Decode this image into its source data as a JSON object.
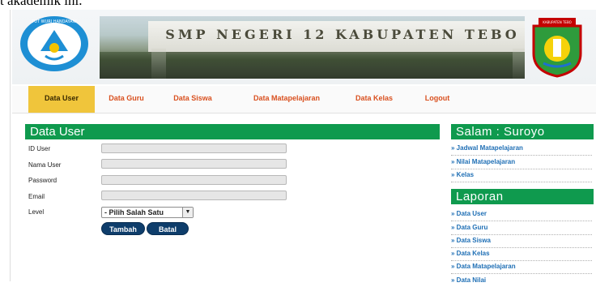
{
  "caption": "t akademik ini.",
  "banner": {
    "school_name": "SMP NEGERI 12 KABUPATEN TEBO",
    "left_logo_text": "TUT WURI HANDAYANI",
    "right_logo_text": "KABUPATEN TEBO"
  },
  "nav": {
    "items": [
      {
        "label": "Data User"
      },
      {
        "label": "Data Guru"
      },
      {
        "label": "Data Siswa"
      },
      {
        "label": "Data Matapelajaran"
      },
      {
        "label": "Data Kelas"
      },
      {
        "label": "Logout"
      }
    ]
  },
  "form": {
    "title": "Data User",
    "fields": [
      {
        "label": "ID User",
        "value": ""
      },
      {
        "label": "Nama User",
        "value": ""
      },
      {
        "label": "Password",
        "value": ""
      },
      {
        "label": "Email",
        "value": ""
      }
    ],
    "level_label": "Level",
    "level_selected": "- Pilih Salah Satu",
    "buttons": {
      "add": "Tambah",
      "cancel": "Batal"
    }
  },
  "sidebar": {
    "greeting_title": "Salam : Suroyo",
    "greeting_links": [
      {
        "label": "» Jadwal Matapelajaran"
      },
      {
        "label": "» Nilai Matapelajaran"
      },
      {
        "label": "» Kelas"
      }
    ],
    "report_title": "Laporan",
    "report_links": [
      {
        "label": "» Data User"
      },
      {
        "label": "» Data Guru"
      },
      {
        "label": "» Data Siswa"
      },
      {
        "label": "» Data Kelas"
      },
      {
        "label": "» Data Matapelajaran"
      },
      {
        "label": "» Data Nilai"
      }
    ]
  },
  "colors": {
    "accent_green": "#0f9a4e",
    "nav_active": "#f0c53b",
    "nav_text": "#d9501f",
    "button": "#0e3d6b",
    "link": "#1f6fb5"
  }
}
